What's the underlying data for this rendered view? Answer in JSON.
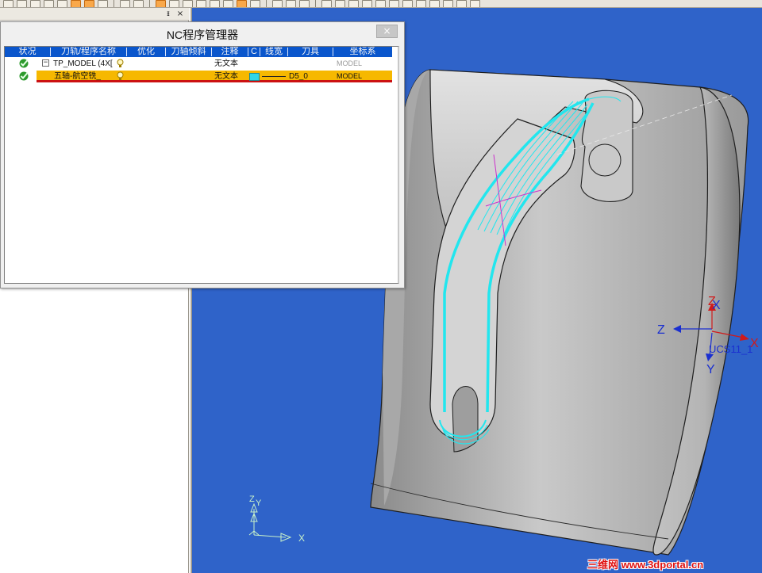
{
  "nc_manager": {
    "title": "NC程序管理器",
    "close_glyph": "×",
    "columns": [
      "状况",
      "刀轨/程序名称",
      "优化",
      "刀轴倾斜",
      "注释",
      "C",
      "线宽",
      "刀具",
      "坐标系"
    ],
    "rows": [
      {
        "status": "ok",
        "expander": "−",
        "name": "TP_MODEL (4X[",
        "comment": "无文本",
        "tool": "",
        "csys": "MODEL",
        "selected": false
      },
      {
        "status": "ok",
        "name": "五轴-航空铣_",
        "comment": "无文本",
        "color": "#2fd6e6",
        "tool": "D5_0",
        "csys": "MODEL",
        "selected": true
      }
    ]
  },
  "dock": {
    "pin_glyph": "ᵻ",
    "close_glyph": "×"
  },
  "viewport": {
    "background": "#2f63c9",
    "toolpath_color": "#22e6ee",
    "axis_labels": {
      "view_triad_z": "Z",
      "view_triad_y": "Y",
      "view_triad_x": "X",
      "csys_z_red": "Z",
      "csys_x_blue": "X",
      "csys_z_blue": "Z",
      "csys_x_red": "X",
      "csys_y_blue": "Y",
      "csys_name": "UCS11_1"
    }
  },
  "watermark": "三维网 www.3dportal.cn"
}
